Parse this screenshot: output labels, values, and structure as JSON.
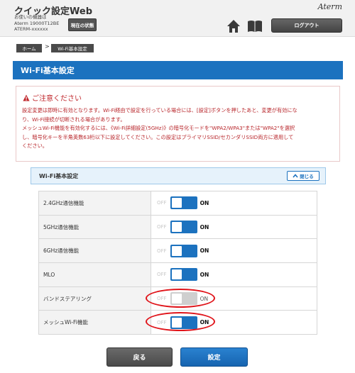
{
  "header": {
    "title": "クイック設定Web",
    "device_line1": "お使いの機器は",
    "device_line2": "Aterm 19000T12BE",
    "device_line3": "ATERM-xxxxxx",
    "status_button": "現在の状態",
    "brand": "Aterm",
    "logout_button": "ログアウト",
    "icons": [
      "home-icon",
      "book-icon"
    ]
  },
  "breadcrumb": {
    "home": "ホーム",
    "separator": ">",
    "current": "Wi-Fi基本設定"
  },
  "page_title": "Wi-Fi基本設定",
  "caution": {
    "heading": "ご注意ください",
    "line1": "設定変更は即時に有効となります。Wi-Fi経由で設定を行っている場合には、[設定]ボタンを押したあと、変更が有効にな",
    "line2": "り、Wi-Fi接続が切断される場合があります。",
    "line3": "メッシュWi-Fi機能を有効化するには、《Wi-Fi詳細設定(5GHz)》の暗号化モードを\"WPA2/WPA3\"または\"WPA2\"を選択",
    "line4": "し、暗号化キーを半角英数63桁以下に設定してください。この設定はプライマリSSID/セカンダリSSID両方に適用して",
    "line5": "ください。"
  },
  "section": {
    "title": "Wi-Fi基本設定",
    "close_button": "閉じる"
  },
  "toggle_labels": {
    "off": "OFF",
    "on": "ON"
  },
  "settings": [
    {
      "label": "2.4GHz通信機能",
      "state": "ON",
      "enabled": true
    },
    {
      "label": "5GHz通信機能",
      "state": "ON",
      "enabled": true
    },
    {
      "label": "6GHz通信機能",
      "state": "ON",
      "enabled": true
    },
    {
      "label": "MLO",
      "state": "ON",
      "enabled": true
    },
    {
      "label": "バンドステアリング",
      "state": "ON",
      "enabled": false
    },
    {
      "label": "メッシュWi-Fi機能",
      "state": "ON",
      "enabled": true
    }
  ],
  "footer": {
    "back_button": "戻る",
    "save_button": "設定"
  },
  "colors": {
    "accent": "#1c72bf",
    "caution_text": "#b8262b",
    "highlight": "#e0141a",
    "toggle_disabled": "#cfcfcf"
  }
}
